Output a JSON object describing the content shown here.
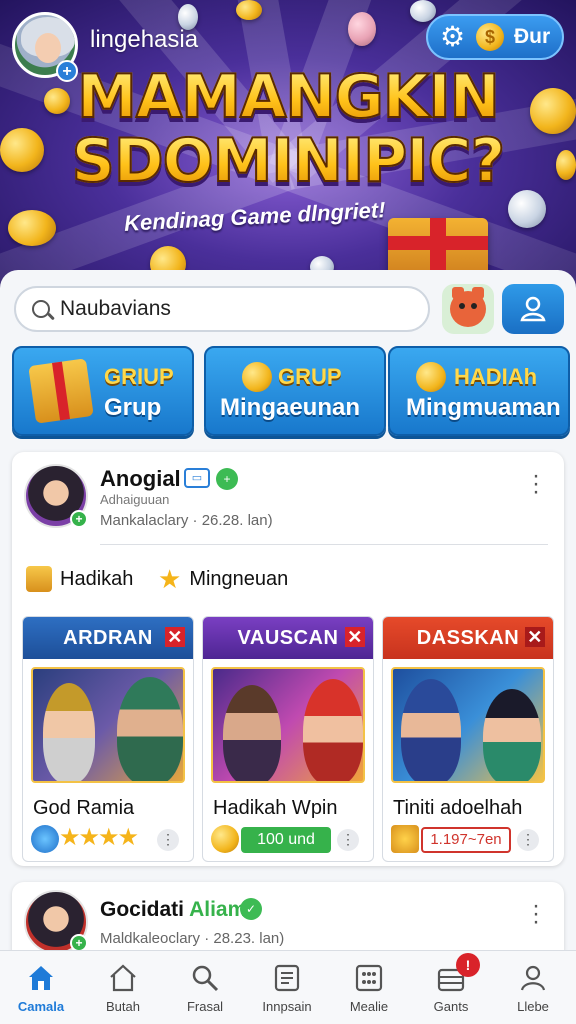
{
  "header": {
    "username": "lingehasia",
    "currency_label": "Đur",
    "title_line1": "MAMANGKIN",
    "title_line2": "SDOMINIPIC?",
    "tagline": "Kendinag Game dlngriet!"
  },
  "search": {
    "value": "Naubavians"
  },
  "categories": [
    {
      "top": "GRIUP",
      "bottom": "Grup"
    },
    {
      "top": "GRUP",
      "bottom": "Mingaeunan"
    },
    {
      "top": "HADIAh",
      "bottom": "Mingmuaman"
    }
  ],
  "post": {
    "name": "Anogial",
    "subtitle": "Adhaiguuan",
    "meta": "Mankalaclary · 26.28. lan)",
    "chips": [
      "Hadikah",
      "Mingneuan"
    ],
    "games": [
      {
        "tag": "ARDRAN",
        "name": "God Ramia",
        "rating": 4
      },
      {
        "tag": "VAUSCAN",
        "name": "Hadikah Wpin",
        "pill": "100 und"
      },
      {
        "tag": "DASSKAN",
        "name": "Tiniti adoelhah",
        "pill": "1.197~7en"
      }
    ]
  },
  "post2": {
    "name": "Gocidati",
    "name_highlight": "Aliam",
    "meta": "Maldkaleoclary · 28.23. lan)"
  },
  "nav": {
    "items": [
      "Camala",
      "Butah",
      "Frasal",
      "Innpsain",
      "Mealie",
      "Gants",
      "Llebe"
    ],
    "badge": "!",
    "active_color": "#1f7bd8"
  },
  "colors": {
    "accent": "#1f7bd8",
    "gold": "#ffc21a",
    "green": "#36b24b",
    "red": "#d0342c"
  }
}
